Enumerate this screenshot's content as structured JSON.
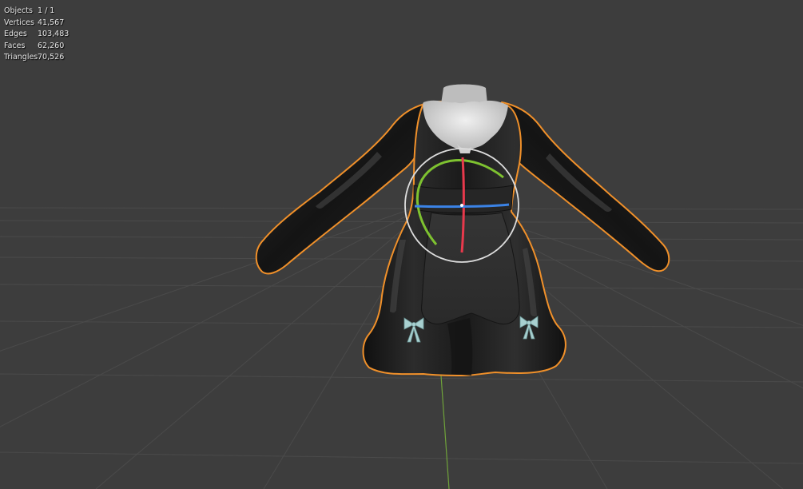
{
  "viewport": {
    "background": "#3d3d3d",
    "grid_color": "#555555",
    "y_axis_color": "#6fa23a",
    "selection_outline_color": "#f0902a"
  },
  "stats": [
    {
      "label": "Objects",
      "value": "1 / 1"
    },
    {
      "label": "Vertices",
      "value": "41,567"
    },
    {
      "label": "Edges",
      "value": "103,483"
    },
    {
      "label": "Faces",
      "value": "62,260"
    },
    {
      "label": "Triangles",
      "value": "70,526"
    }
  ],
  "gizmo": {
    "type": "rotate",
    "x_axis_color": "#e8394c",
    "y_axis_color": "#7ec230",
    "z_axis_color": "#3b83e6",
    "view_ring_color": "#dcdcdc"
  },
  "model": {
    "name": "dress",
    "body_color": "#1c1c1c",
    "collar_color": "#d8d8d8",
    "ribbon_color": "#a8d0d0"
  }
}
